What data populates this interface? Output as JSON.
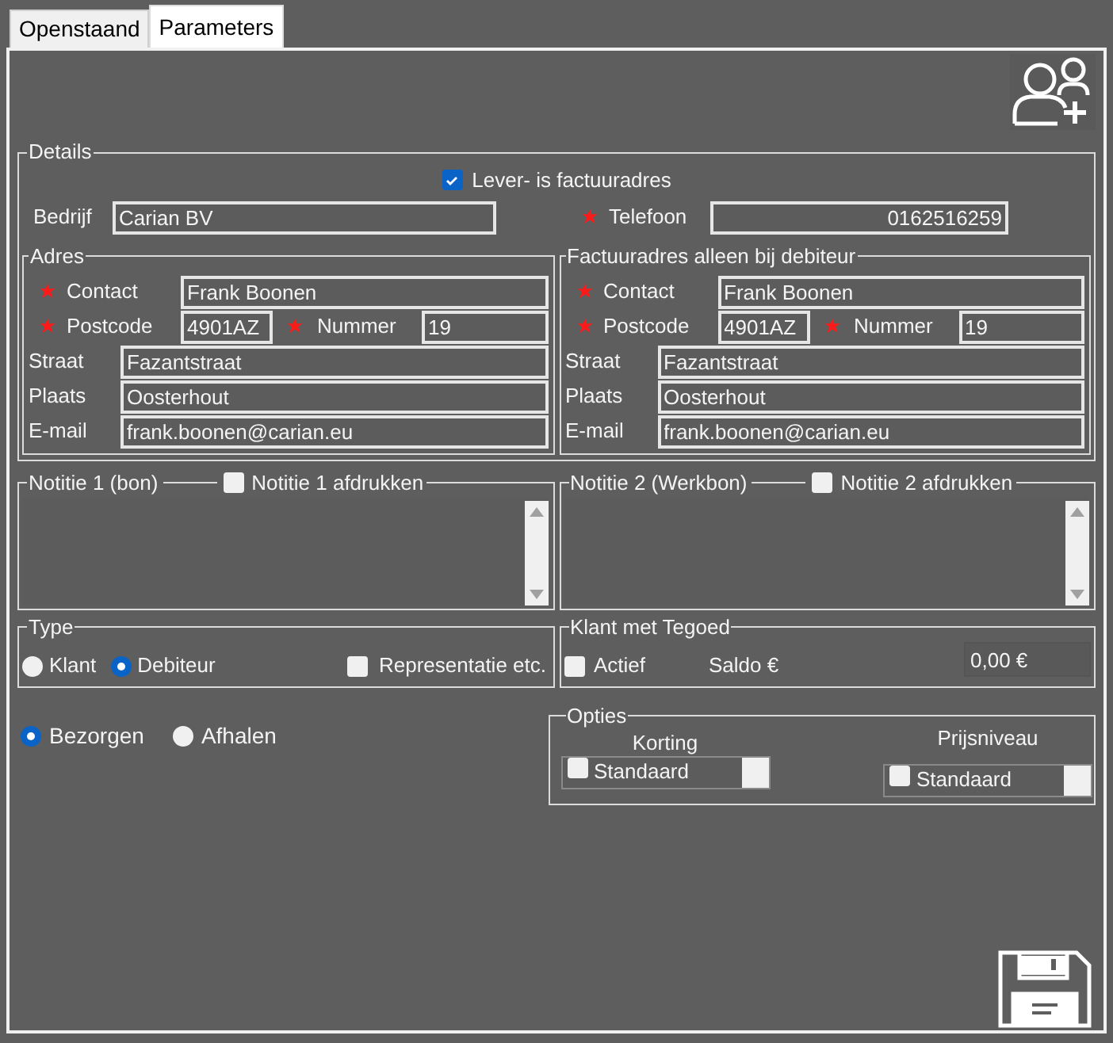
{
  "tabs": [
    {
      "label": "Openstaand",
      "selected": false
    },
    {
      "label": "Parameters",
      "selected": true
    }
  ],
  "details": {
    "legend": "Details",
    "lever_is_factuuradres": {
      "label": "Lever- is factuuradres",
      "checked": true
    },
    "bedrijf": {
      "label": "Bedrijf",
      "value": "Carian BV"
    },
    "telefoon": {
      "label": "Telefoon",
      "value": "0162516259",
      "required": true
    },
    "addresses": [
      {
        "legend": "Adres",
        "contact": {
          "label": "Contact",
          "value": "Frank Boonen",
          "required": true
        },
        "postcode": {
          "label": "Postcode",
          "value": "4901AZ",
          "required": true
        },
        "nummer": {
          "label": "Nummer",
          "value": "19",
          "required": true
        },
        "straat": {
          "label": "Straat",
          "value": "Fazantstraat",
          "required": false
        },
        "plaats": {
          "label": "Plaats",
          "value": "Oosterhout",
          "required": false
        },
        "email": {
          "label": "E-mail",
          "value": "frank.boonen@carian.eu",
          "required": false
        }
      },
      {
        "legend": "Factuuradres alleen bij debiteur",
        "contact": {
          "label": "Contact",
          "value": "Frank Boonen",
          "required": true
        },
        "postcode": {
          "label": "Postcode",
          "value": "4901AZ",
          "required": true
        },
        "nummer": {
          "label": "Nummer",
          "value": "19",
          "required": true
        },
        "straat": {
          "label": "Straat",
          "value": "Fazantstraat",
          "required": false
        },
        "plaats": {
          "label": "Plaats",
          "value": "Oosterhout",
          "required": false
        },
        "email": {
          "label": "E-mail",
          "value": "frank.boonen@carian.eu",
          "required": false
        }
      }
    ]
  },
  "notes": [
    {
      "legend": "Notitie 1 (bon)",
      "print": {
        "label": "Notitie 1 afdrukken",
        "checked": false
      }
    },
    {
      "legend": "Notitie 2 (Werkbon)",
      "print": {
        "label": "Notitie 2 afdrukken",
        "checked": false
      }
    }
  ],
  "type": {
    "legend": "Type",
    "options": [
      {
        "label": "Klant",
        "selected": false
      },
      {
        "label": "Debiteur",
        "selected": true
      }
    ],
    "representatie": {
      "label": "Representatie etc.",
      "checked": false
    }
  },
  "tegoed": {
    "legend": "Klant met Tegoed",
    "actief": {
      "label": "Actief",
      "checked": false
    },
    "saldo_label": "Saldo €",
    "saldo_value": "0,00 €"
  },
  "delivery": [
    {
      "label": "Bezorgen",
      "selected": true
    },
    {
      "label": "Afhalen",
      "selected": false
    }
  ],
  "opties": {
    "legend": "Opties",
    "selects": [
      {
        "label": "Korting",
        "value": "Standaard",
        "checked": false
      },
      {
        "label": "Prijsniveau",
        "value": "Standaard",
        "checked": false
      }
    ]
  }
}
